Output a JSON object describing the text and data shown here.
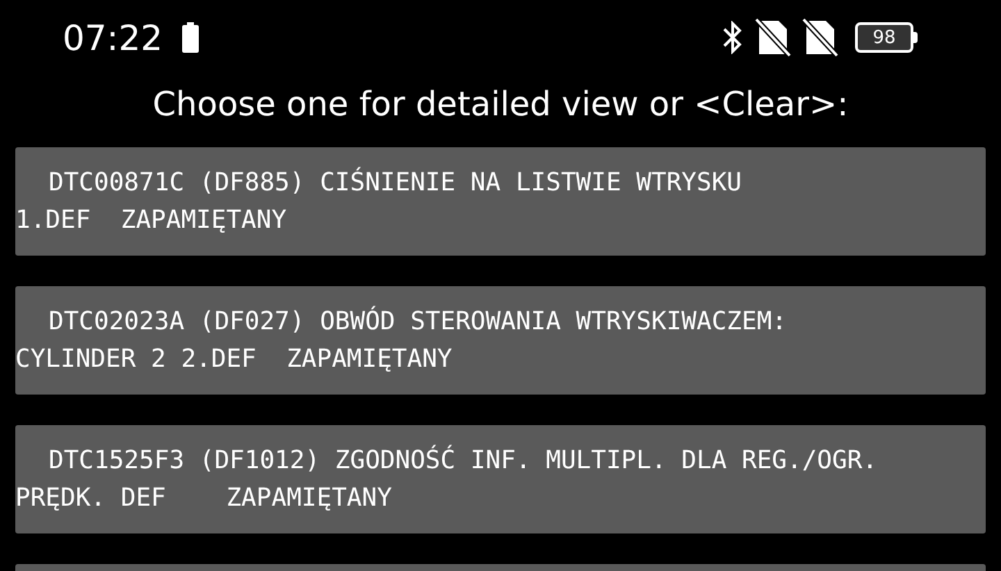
{
  "status_bar": {
    "time": "07:22",
    "battery_percent": "98"
  },
  "prompt": "Choose one for detailed view or <Clear>:",
  "faults": [
    {
      "line_1": "DTC00871C (DF885) CIŚNIENIE NA LISTWIE WTRYSKU",
      "line_2": "1.DEF  ZAPAMIĘTANY"
    },
    {
      "line_1": "DTC02023A (DF027) OBWÓD STEROWANIA WTRYSKIWACZEM:",
      "line_2": "CYLINDER 2 2.DEF  ZAPAMIĘTANY"
    },
    {
      "line_1": "DTC1525F3 (DF1012) ZGODNOŚĆ INF. MULTIPL. DLA REG./OGR.",
      "line_2": "PRĘDK. DEF    ZAPAMIĘTANY"
    }
  ],
  "more_items_below": true
}
